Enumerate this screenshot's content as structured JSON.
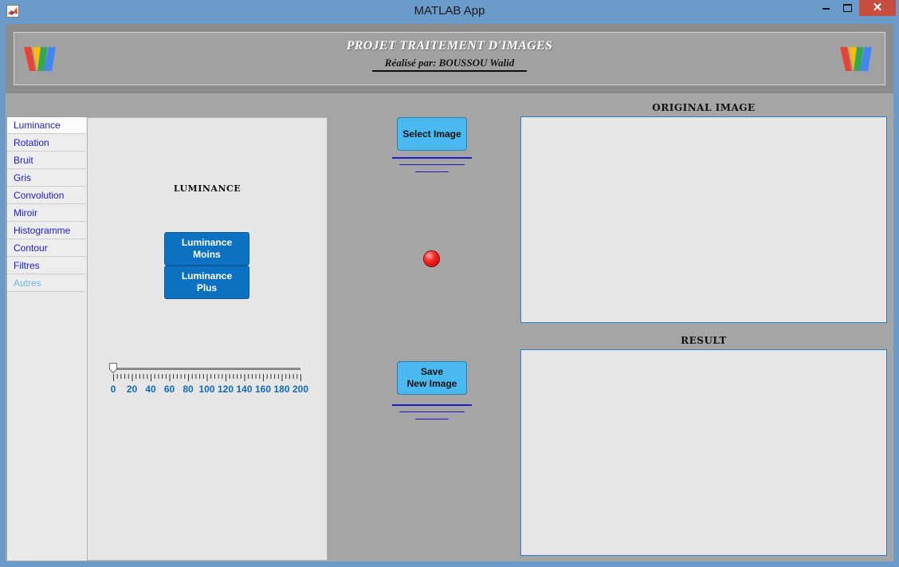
{
  "window": {
    "title": "MATLAB App",
    "minimize_icon": "minimize-icon",
    "maximize_icon": "maximize-icon",
    "close_label": "✕",
    "app_icon": "matlab-icon"
  },
  "header": {
    "title": "PROJET TRAITEMENT D'IMAGES",
    "author": "Réalisé par: BOUSSOU Walid",
    "logo_icon": "w-logo-icon"
  },
  "tabs": {
    "items": [
      {
        "label": "Luminance",
        "state": "active"
      },
      {
        "label": "Rotation",
        "state": "normal"
      },
      {
        "label": "Bruit",
        "state": "normal"
      },
      {
        "label": "Gris",
        "state": "normal"
      },
      {
        "label": "Convolution",
        "state": "normal"
      },
      {
        "label": "Miroir",
        "state": "normal"
      },
      {
        "label": "Histogramme",
        "state": "normal"
      },
      {
        "label": "Contour",
        "state": "normal"
      },
      {
        "label": "Filtres",
        "state": "normal"
      },
      {
        "label": "Autres",
        "state": "disabled"
      }
    ]
  },
  "luminance_panel": {
    "heading": "LUMINANCE",
    "moins_line1": "Luminance",
    "moins_line2": "Moins",
    "plus_line1": "Luminance",
    "plus_line2": "Plus",
    "slider": {
      "min": 0,
      "max": 200,
      "value": 0,
      "tick_labels": [
        "0",
        "20",
        "40",
        "60",
        "80",
        "100",
        "120",
        "140",
        "160",
        "180",
        "200"
      ]
    }
  },
  "controls": {
    "select_label": "Select Image",
    "save_line1": "Save",
    "save_line2": "New Image",
    "lamp_color": "#ff2a2a"
  },
  "display": {
    "original_label": "ORIGINAL IMAGE",
    "result_label": "RESULT"
  },
  "colors": {
    "title_bar": "#6b9bcb",
    "background": "#a5a5a5",
    "blue_button": "#0d71c2",
    "cyan_button": "#4ab9f0",
    "tab_text": "#1a1bcc",
    "axes_border": "#2b7fd1"
  }
}
